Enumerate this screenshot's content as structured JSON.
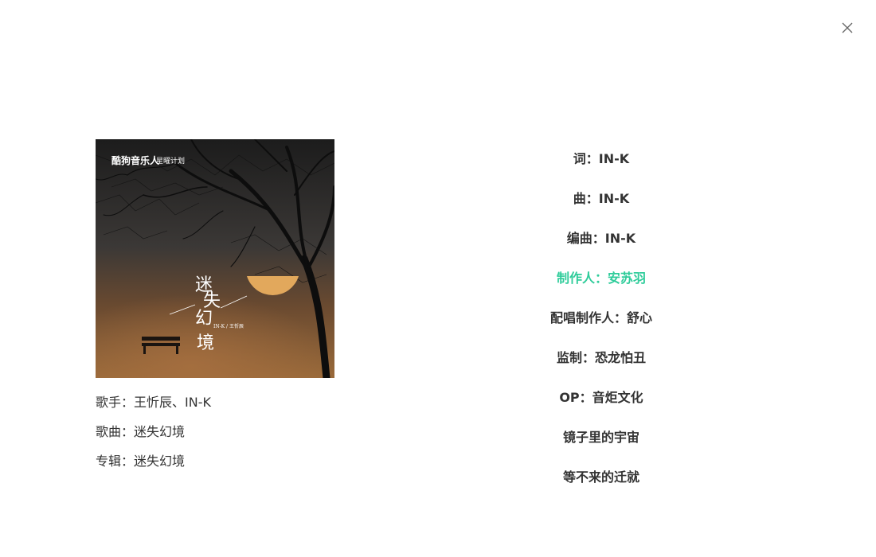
{
  "window": {
    "close_icon": "close-icon"
  },
  "cover": {
    "brand_text": "酷狗音乐人",
    "plan_text": "星曜计划",
    "title_chars": [
      "迷",
      "失",
      "幻",
      "境"
    ],
    "artist_text": "IN-K / 王忻辰",
    "colors": {
      "sky_top": "#202020",
      "sky_mid": "#3a3634",
      "ground": "#8a5a30",
      "moon": "#e2a85c"
    }
  },
  "song": {
    "singer_label": "歌手：",
    "singer_value": "王忻辰、IN-K",
    "song_label": "歌曲：",
    "song_value": "迷失幻境",
    "album_label": "专辑：",
    "album_value": "迷失幻境"
  },
  "lyrics": {
    "active_index": 3,
    "active_color": "#2ecc9a",
    "lines": [
      "词：IN-K",
      "曲：IN-K",
      "编曲：IN-K",
      "制作人：安苏羽",
      "配唱制作人：舒心",
      "监制：恐龙怕丑",
      "OP：音炬文化",
      "镜子里的宇宙",
      "等不来的迁就"
    ]
  }
}
